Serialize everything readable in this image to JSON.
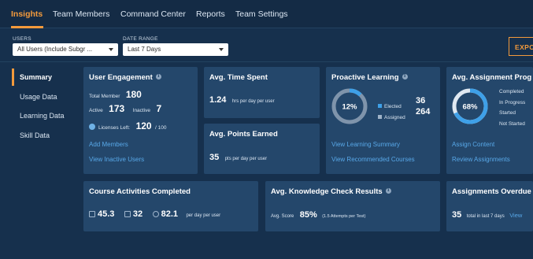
{
  "nav": {
    "tabs": [
      "Insights",
      "Team Members",
      "Command Center",
      "Reports",
      "Team Settings"
    ],
    "active_tab": "Insights"
  },
  "filters": {
    "users_label": "USERS",
    "users_value": "All Users (Include Subgr ...",
    "date_label": "DATE RANGE",
    "date_value": "Last 7 Days",
    "export_label": "EXPO"
  },
  "sidebar": {
    "items": [
      {
        "label": "Summary",
        "active": true
      },
      {
        "label": "Usage Data"
      },
      {
        "label": "Learning Data"
      },
      {
        "label": "Skill Data"
      }
    ]
  },
  "user_engagement": {
    "title": "User Engagement",
    "total_label": "Total Member",
    "total_value": "180",
    "active_label": "Active",
    "active_value": "173",
    "inactive_label": "Inactive",
    "inactive_value": "7",
    "licenses_label": "Licenses Left:",
    "licenses_value": "120",
    "licenses_total": "/ 100",
    "add_members": "Add Members",
    "view_inactive": "View Inactive Users"
  },
  "time_spent": {
    "title": "Avg. Time Spent",
    "value": "1.24",
    "unit": "hrs per day per user"
  },
  "points": {
    "title": "Avg. Points Earned",
    "value": "35",
    "unit": "pts per day per user"
  },
  "proactive": {
    "title": "Proactive Learning",
    "percent": "12%",
    "percent_value": 12,
    "elected_label": "Elected",
    "elected_value": "36",
    "assigned_label": "Assigned",
    "assigned_value": "264",
    "link1": "View Learning Summary",
    "link2": "View Recommended Courses",
    "colors": {
      "elected": "#3ea0e8",
      "assigned": "#9fb3c8"
    }
  },
  "assignment": {
    "title": "Avg. Assignment Prog",
    "percent": "68%",
    "percent_value": 68,
    "legend": [
      "Completed",
      "In Progress",
      "Started",
      "Not Started"
    ],
    "link1": "Assign Content",
    "link2": "Review Assignments"
  },
  "courses": {
    "title": "Course Activities Completed",
    "v1": "45.3",
    "v2": "32",
    "v3": "82.1",
    "unit": "per day per user"
  },
  "knowledge": {
    "title": "Avg. Knowledge Check Results",
    "score_label": "Avg. Score",
    "score_value": "85%",
    "attempts": "(1.5 Attempts per Test)"
  },
  "overdue": {
    "title": "Assignments Overdue",
    "value": "35",
    "unit": "total in last 7 days",
    "link": "View"
  }
}
